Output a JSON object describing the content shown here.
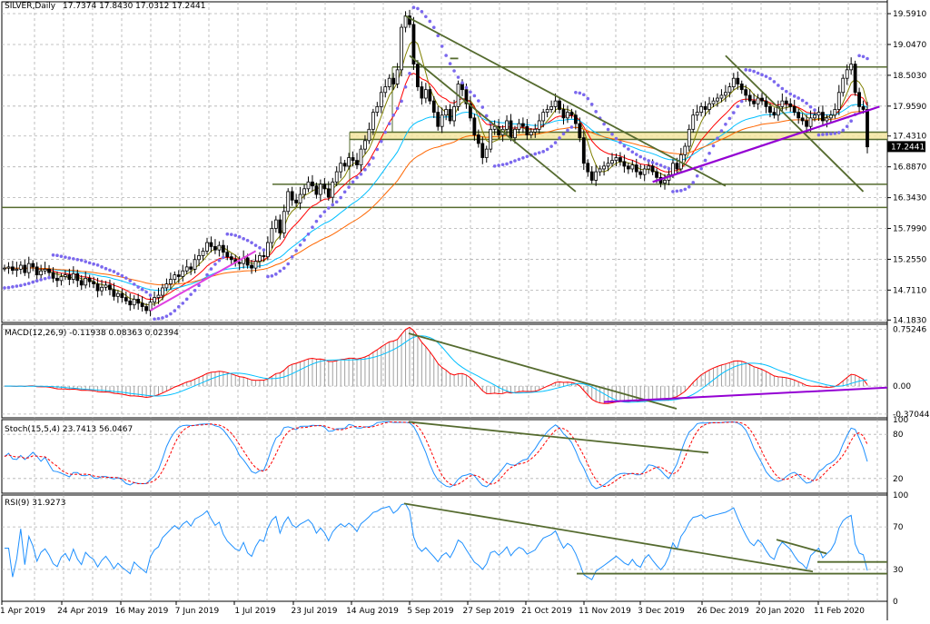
{
  "chart_data": {
    "type": "candlestick",
    "symbol_label": "SILVER,Daily",
    "ohlc_text": "17.7374 17.8430 17.0312 17.2441",
    "last_price": "17.2441",
    "price_ticks": [
      "19.5910",
      "19.0470",
      "18.5030",
      "17.9590",
      "17.4310",
      "16.8870",
      "16.3430",
      "15.7990",
      "15.2550",
      "14.7110",
      "14.1830"
    ],
    "price_tick_values": [
      19.591,
      19.047,
      18.503,
      17.959,
      17.431,
      16.887,
      16.343,
      15.799,
      15.255,
      14.711,
      14.183
    ],
    "price_range": [
      14.14,
      19.8
    ],
    "date_ticks": [
      "1 Apr 2019",
      "24 Apr 2019",
      "16 May 2019",
      "7 Jun 2019",
      "1 Jul 2019",
      "23 Jul 2019",
      "14 Aug 2019",
      "5 Sep 2019",
      "27 Sep 2019",
      "21 Oct 2019",
      "11 Nov 2019",
      "3 Dec 2019",
      "26 Dec 2019",
      "20 Jan 2020",
      "11 Feb 2020"
    ],
    "closes": [
      15.1,
      15.12,
      15.06,
      15.08,
      15.15,
      15.02,
      15.18,
      15.12,
      14.98,
      15.05,
      15.08,
      15.02,
      14.92,
      14.88,
      14.95,
      14.98,
      14.9,
      15.0,
      14.88,
      14.8,
      14.92,
      14.86,
      14.82,
      14.7,
      14.76,
      14.8,
      14.72,
      14.6,
      14.65,
      14.58,
      14.52,
      14.45,
      14.55,
      14.48,
      14.42,
      14.35,
      14.5,
      14.58,
      14.62,
      14.75,
      14.82,
      14.9,
      14.98,
      14.95,
      15.05,
      15.12,
      15.08,
      15.25,
      15.32,
      15.4,
      15.55,
      15.48,
      15.42,
      15.5,
      15.38,
      15.3,
      15.25,
      15.2,
      15.18,
      15.28,
      15.15,
      15.1,
      15.22,
      15.32,
      15.3,
      15.55,
      15.8,
      15.95,
      15.72,
      16.1,
      16.45,
      16.3,
      16.25,
      16.4,
      16.5,
      16.62,
      16.55,
      16.4,
      16.58,
      16.5,
      16.35,
      16.62,
      16.8,
      16.95,
      16.9,
      17.05,
      17.0,
      16.92,
      17.2,
      17.35,
      17.55,
      17.85,
      17.95,
      18.2,
      18.3,
      18.45,
      18.35,
      18.6,
      19.35,
      19.55,
      19.4,
      18.7,
      18.3,
      18.1,
      18.25,
      18.05,
      17.85,
      17.6,
      17.8,
      17.9,
      17.7,
      17.95,
      18.35,
      18.25,
      18.0,
      17.75,
      17.45,
      17.3,
      17.05,
      17.2,
      17.55,
      17.6,
      17.45,
      17.55,
      17.7,
      17.4,
      17.55,
      17.65,
      17.6,
      17.45,
      17.5,
      17.55,
      17.7,
      17.85,
      17.9,
      17.95,
      18.05,
      17.9,
      17.75,
      17.85,
      17.8,
      17.65,
      17.4,
      16.95,
      16.8,
      16.65,
      16.8,
      16.85,
      16.9,
      16.95,
      17.0,
      17.05,
      16.98,
      16.9,
      16.85,
      16.92,
      16.8,
      16.75,
      16.85,
      16.9,
      16.8,
      16.7,
      16.6,
      16.65,
      16.75,
      16.95,
      16.85,
      17.1,
      17.25,
      17.55,
      17.8,
      17.85,
      17.95,
      17.9,
      18.0,
      18.05,
      18.1,
      18.15,
      18.2,
      18.3,
      18.45,
      18.35,
      18.25,
      18.15,
      18.05,
      18.0,
      18.1,
      18.05,
      17.95,
      17.85,
      17.8,
      17.95,
      18.05,
      18.0,
      17.95,
      17.85,
      17.75,
      17.7,
      17.6,
      17.75,
      17.8,
      17.85,
      17.7,
      17.75,
      17.8,
      17.9,
      18.2,
      18.45,
      18.6,
      18.7,
      18.2,
      17.95,
      17.9,
      17.24
    ],
    "series": [
      {
        "name": "",
        "color": "#808000",
        "values": []
      },
      {
        "name": "",
        "color": "#ff0000",
        "values": []
      },
      {
        "name": "",
        "color": "#00bfff",
        "values": []
      },
      {
        "name": "",
        "color": "#ff6600",
        "values": []
      }
    ],
    "horizontal_levels": [
      18.65,
      17.5,
      17.37,
      16.58,
      16.17
    ],
    "parabolic_sar_color": "#7b68ee",
    "trendline_color": "#556b2f",
    "uptrend_color": "#9400d3",
    "highlight_zone": [
      17.37,
      17.5
    ],
    "highlight_zone_color": "#f5e6a0",
    "macd": {
      "label": "MACD(12,26,9) -0.11938 0.08363 0.02394",
      "ticks": [
        "0.75246",
        "0.00",
        "-0.37044"
      ],
      "tick_values": [
        0.75246,
        0.0,
        -0.37044
      ],
      "range": [
        -0.42,
        0.82
      ]
    },
    "stoch": {
      "label": "Stoch(15,5,4) 23.7413 56.0467",
      "ticks": [
        "100",
        "80",
        "20",
        "0"
      ],
      "tick_values": [
        100,
        80,
        20,
        0
      ]
    },
    "rsi": {
      "label": "RSI(9) 31.9273",
      "ticks": [
        "100",
        "70",
        "30",
        "0"
      ],
      "tick_values": [
        100,
        70,
        30,
        0
      ]
    }
  }
}
